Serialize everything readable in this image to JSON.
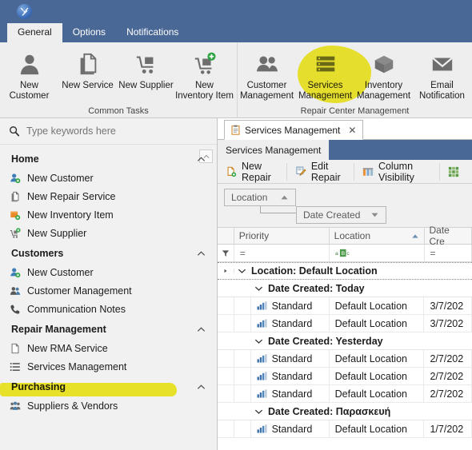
{
  "window": {
    "icon": "tools-icon",
    "accent": "#4a6896",
    "highlight_color": "#f5ec13"
  },
  "ribbon": {
    "tabs": [
      {
        "label": "General",
        "active": true
      },
      {
        "label": "Options",
        "active": false
      },
      {
        "label": "Notifications",
        "active": false
      }
    ],
    "groups": [
      {
        "title": "Common Tasks",
        "buttons": [
          {
            "label": "New Customer",
            "icon": "person-icon"
          },
          {
            "label": "New Service",
            "icon": "documents-icon"
          },
          {
            "label": "New Supplier",
            "icon": "cart-icon"
          },
          {
            "label": "New Inventory Item",
            "icon": "cart-plus-icon"
          }
        ]
      },
      {
        "title": "Repair Center Management",
        "buttons": [
          {
            "label": "Customer Management",
            "icon": "people-icon"
          },
          {
            "label": "Services Management",
            "icon": "list-icon",
            "highlighted": true
          },
          {
            "label": "Inventory Management",
            "icon": "box-icon"
          },
          {
            "label": "Email Notification",
            "icon": "envelope-icon"
          }
        ]
      }
    ]
  },
  "sidebar": {
    "search": {
      "placeholder": "Type keywords here",
      "value": "",
      "icon": "search-icon"
    },
    "scroll_up_icon": "scroll-up-icon",
    "sections": [
      {
        "title": "Home",
        "items": [
          {
            "label": "New Customer",
            "icon": "person-add-icon"
          },
          {
            "label": "New Repair Service",
            "icon": "documents-icon"
          },
          {
            "label": "New Inventory Item",
            "icon": "box-add-icon"
          },
          {
            "label": "New Supplier",
            "icon": "cart-add-icon"
          }
        ]
      },
      {
        "title": "Customers",
        "items": [
          {
            "label": "New Customer",
            "icon": "person-add-icon"
          },
          {
            "label": "Customer Management",
            "icon": "people-icon"
          },
          {
            "label": "Communication Notes",
            "icon": "phone-icon"
          }
        ]
      },
      {
        "title": "Repair Management",
        "items": [
          {
            "label": "New RMA Service",
            "icon": "document-icon"
          },
          {
            "label": "Services Management",
            "icon": "list-icon",
            "highlighted": true
          }
        ]
      },
      {
        "title": "Purchasing",
        "items": [
          {
            "label": "Suppliers & Vendors",
            "icon": "people-group-icon"
          }
        ]
      }
    ]
  },
  "main": {
    "document_tab": {
      "label": "Services Management",
      "icon": "clipboard-icon",
      "close_icon": "close-icon"
    },
    "sub_tab": {
      "label": "Services Management"
    },
    "toolbar": [
      {
        "label": "New Repair",
        "icon": "new-repair-icon"
      },
      {
        "label": "Edit Repair",
        "icon": "edit-repair-icon"
      },
      {
        "label": "Column Visibility",
        "icon": "columns-icon"
      },
      {
        "label": "",
        "icon": "grid-icon"
      }
    ],
    "group_panel": [
      {
        "label": "Location",
        "sort": "asc",
        "sort_icon": "sort-asc-icon"
      },
      {
        "label": "Date Created",
        "sort": "desc",
        "sort_icon": "sort-desc-icon"
      }
    ],
    "grid": {
      "columns": [
        {
          "label": "Priority",
          "sorted": false
        },
        {
          "label": "Location",
          "sorted": true,
          "sort_icon": "sort-asc-icon"
        },
        {
          "label": "Date Cre",
          "sorted": false
        }
      ],
      "filter_row": {
        "funnel_icon": "filter-funnel-icon",
        "cells": [
          {
            "value": "=",
            "icon": "equals-icon"
          },
          {
            "value": "",
            "icon": "abc-icon"
          },
          {
            "value": "=",
            "icon": "equals-icon"
          }
        ]
      },
      "rows": [
        {
          "type": "group",
          "level": 1,
          "label": "Location: Default Location",
          "expanded": true,
          "expand_icon": "chevron-down-icon",
          "row_indicator": "play-icon"
        },
        {
          "type": "group",
          "level": 2,
          "label": "Date Created: Today",
          "expanded": true,
          "expand_icon": "chevron-down-icon"
        },
        {
          "type": "data",
          "priority": "Standard",
          "priority_icon": "bars-icon",
          "location": "Default Location",
          "date": "3/7/202"
        },
        {
          "type": "data",
          "priority": "Standard",
          "priority_icon": "bars-icon",
          "location": "Default Location",
          "date": "3/7/202"
        },
        {
          "type": "group",
          "level": 2,
          "label": "Date Created: Yesterday",
          "expanded": true,
          "expand_icon": "chevron-down-icon"
        },
        {
          "type": "data",
          "priority": "Standard",
          "priority_icon": "bars-icon",
          "location": "Default Location",
          "date": "2/7/202"
        },
        {
          "type": "data",
          "priority": "Standard",
          "priority_icon": "bars-icon",
          "location": "Default Location",
          "date": "2/7/202"
        },
        {
          "type": "data",
          "priority": "Standard",
          "priority_icon": "bars-icon",
          "location": "Default Location",
          "date": "2/7/202"
        },
        {
          "type": "group",
          "level": 2,
          "label": "Date Created: Παρασκευή",
          "expanded": true,
          "expand_icon": "chevron-down-icon"
        },
        {
          "type": "data",
          "priority": "Standard",
          "priority_icon": "bars-icon",
          "location": "Default Location",
          "date": "1/7/202"
        }
      ]
    }
  }
}
